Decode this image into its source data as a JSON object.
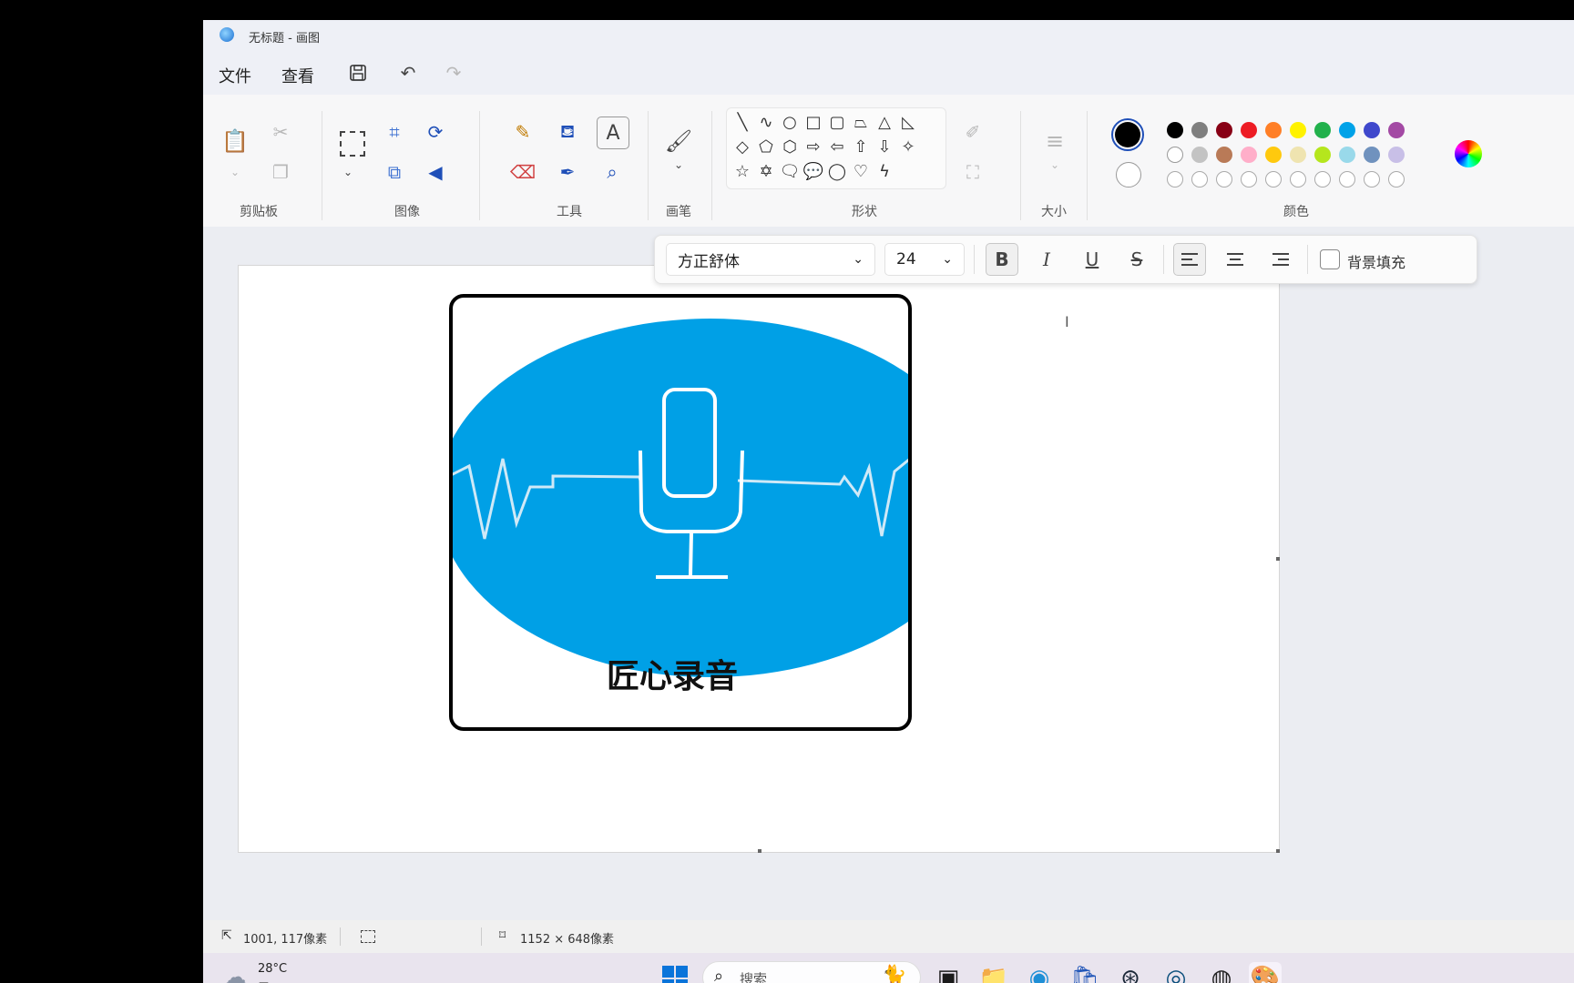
{
  "window": {
    "title": "无标题 - 画图"
  },
  "menu": {
    "file": "文件",
    "view": "查看"
  },
  "ribbon": {
    "groups": {
      "clipboard": "剪贴板",
      "image": "图像",
      "tools": "工具",
      "brushes": "画笔",
      "shapes": "形状",
      "size": "大小",
      "colors": "颜色"
    },
    "palette_row1": [
      "#000000",
      "#7f7f7f",
      "#880015",
      "#ed1c24",
      "#ff7f27",
      "#fff200",
      "#22b14c",
      "#00a2e8",
      "#3f48cc",
      "#a349a4"
    ],
    "palette_row2": [
      "#ffffff",
      "#c3c3c3",
      "#b97a57",
      "#ffaec9",
      "#ffc90e",
      "#efe4b0",
      "#b5e61d",
      "#99d9ea",
      "#7092be",
      "#c8bfe7"
    ],
    "primary_color": "#000000",
    "secondary_color": "#ffffff"
  },
  "text_format": {
    "font": "方正舒体",
    "size": "24",
    "bold": "B",
    "italic": "I",
    "underline": "U",
    "strike": "S",
    "bg_fill_label": "背景填充"
  },
  "artwork": {
    "caption": "匠心录音",
    "ellipse_color": "#00a0e6"
  },
  "status": {
    "cursor_pos": "1001, 117像素",
    "canvas_size": "1152 × 648像素"
  },
  "taskbar": {
    "weather_temp": "28°C",
    "weather_desc": "雾",
    "search_placeholder": "搜索"
  }
}
